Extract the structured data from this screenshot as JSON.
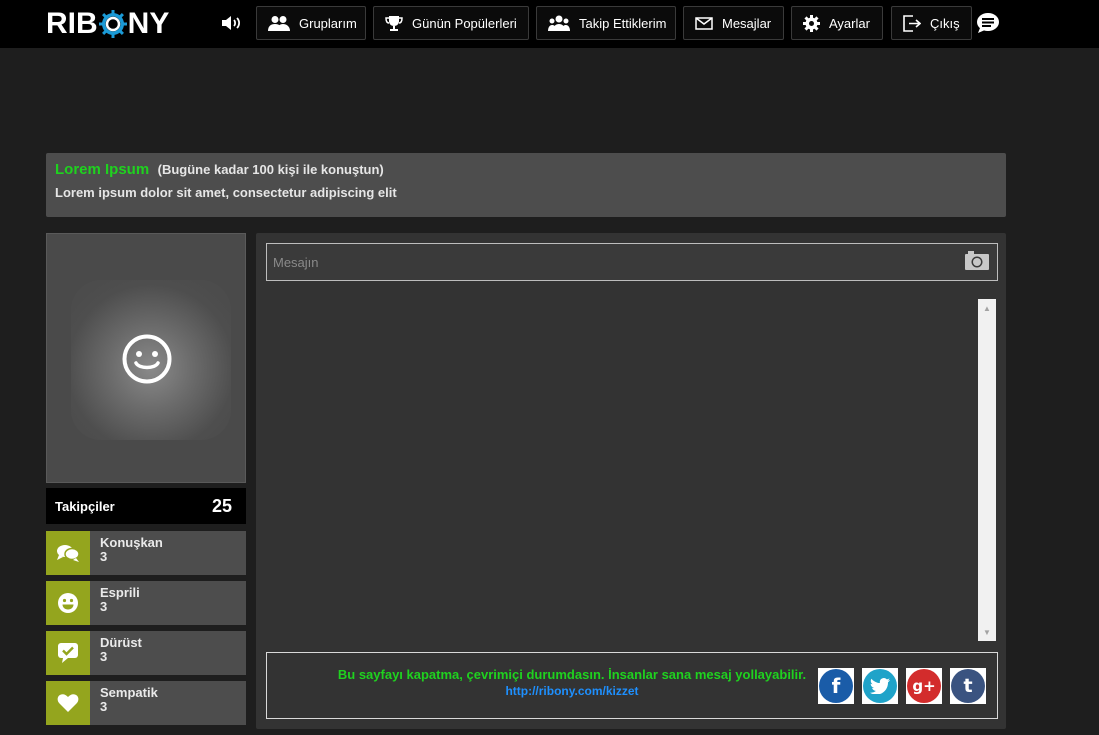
{
  "brand": {
    "logo_left": "RIB",
    "logo_right": "NY"
  },
  "nav": {
    "items": [
      {
        "label": "Gruplarım",
        "icon": "group-icon"
      },
      {
        "label": "Günün Popülerleri",
        "icon": "trophy-icon"
      },
      {
        "label": "Takip Ettiklerim",
        "icon": "following-icon"
      },
      {
        "label": "Mesajlar",
        "icon": "envelope-icon"
      },
      {
        "label": "Ayarlar",
        "icon": "gear-icon"
      },
      {
        "label": "Çıkış",
        "icon": "logout-icon"
      }
    ]
  },
  "profile": {
    "name": "Lorem Ipsum",
    "talk_count_text": "(Bugüne kadar 100 kişi ile konuştun)",
    "bio": "Lorem ipsum dolor sit amet, consectetur adipiscing elit"
  },
  "followers": {
    "label": "Takipçiler",
    "count": "25"
  },
  "traits": [
    {
      "label": "Konuşkan",
      "value": "3",
      "icon": "speech-bubbles-icon"
    },
    {
      "label": "Esprili",
      "value": "3",
      "icon": "smile-icon"
    },
    {
      "label": "Dürüst",
      "value": "3",
      "icon": "check-bubble-icon"
    },
    {
      "label": "Sempatik",
      "value": "3",
      "icon": "heart-icon"
    }
  ],
  "composer": {
    "placeholder": "Mesajın"
  },
  "status": {
    "message": "Bu sayfayı kapatma, çevrimiçi durumdasın. İnsanlar sana mesaj yollayabilir.",
    "link": "http://ribony.com/kizzet"
  },
  "social": [
    {
      "name": "facebook",
      "glyph": "f",
      "color": "#1a5ca8"
    },
    {
      "name": "twitter",
      "glyph": "t",
      "color": "#1fa3c9"
    },
    {
      "name": "google-plus",
      "glyph": "g+",
      "color": "#d32c2c"
    },
    {
      "name": "tumblr",
      "glyph": "t",
      "color": "#3a5380"
    }
  ],
  "colors": {
    "accent_green": "#1fd21f",
    "trait_icon_bg": "#94a51e",
    "link_blue": "#1e90ff"
  }
}
